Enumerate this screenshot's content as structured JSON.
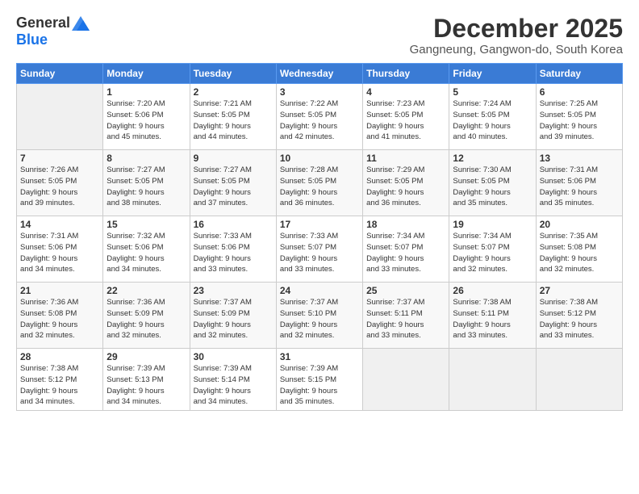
{
  "logo": {
    "general": "General",
    "blue": "Blue"
  },
  "title": "December 2025",
  "location": "Gangneung, Gangwon-do, South Korea",
  "days_of_week": [
    "Sunday",
    "Monday",
    "Tuesday",
    "Wednesday",
    "Thursday",
    "Friday",
    "Saturday"
  ],
  "weeks": [
    [
      {
        "day": "",
        "info": ""
      },
      {
        "day": "1",
        "info": "Sunrise: 7:20 AM\nSunset: 5:06 PM\nDaylight: 9 hours\nand 45 minutes."
      },
      {
        "day": "2",
        "info": "Sunrise: 7:21 AM\nSunset: 5:05 PM\nDaylight: 9 hours\nand 44 minutes."
      },
      {
        "day": "3",
        "info": "Sunrise: 7:22 AM\nSunset: 5:05 PM\nDaylight: 9 hours\nand 42 minutes."
      },
      {
        "day": "4",
        "info": "Sunrise: 7:23 AM\nSunset: 5:05 PM\nDaylight: 9 hours\nand 41 minutes."
      },
      {
        "day": "5",
        "info": "Sunrise: 7:24 AM\nSunset: 5:05 PM\nDaylight: 9 hours\nand 40 minutes."
      },
      {
        "day": "6",
        "info": "Sunrise: 7:25 AM\nSunset: 5:05 PM\nDaylight: 9 hours\nand 39 minutes."
      }
    ],
    [
      {
        "day": "7",
        "info": "Sunrise: 7:26 AM\nSunset: 5:05 PM\nDaylight: 9 hours\nand 39 minutes."
      },
      {
        "day": "8",
        "info": "Sunrise: 7:27 AM\nSunset: 5:05 PM\nDaylight: 9 hours\nand 38 minutes."
      },
      {
        "day": "9",
        "info": "Sunrise: 7:27 AM\nSunset: 5:05 PM\nDaylight: 9 hours\nand 37 minutes."
      },
      {
        "day": "10",
        "info": "Sunrise: 7:28 AM\nSunset: 5:05 PM\nDaylight: 9 hours\nand 36 minutes."
      },
      {
        "day": "11",
        "info": "Sunrise: 7:29 AM\nSunset: 5:05 PM\nDaylight: 9 hours\nand 36 minutes."
      },
      {
        "day": "12",
        "info": "Sunrise: 7:30 AM\nSunset: 5:05 PM\nDaylight: 9 hours\nand 35 minutes."
      },
      {
        "day": "13",
        "info": "Sunrise: 7:31 AM\nSunset: 5:06 PM\nDaylight: 9 hours\nand 35 minutes."
      }
    ],
    [
      {
        "day": "14",
        "info": "Sunrise: 7:31 AM\nSunset: 5:06 PM\nDaylight: 9 hours\nand 34 minutes."
      },
      {
        "day": "15",
        "info": "Sunrise: 7:32 AM\nSunset: 5:06 PM\nDaylight: 9 hours\nand 34 minutes."
      },
      {
        "day": "16",
        "info": "Sunrise: 7:33 AM\nSunset: 5:06 PM\nDaylight: 9 hours\nand 33 minutes."
      },
      {
        "day": "17",
        "info": "Sunrise: 7:33 AM\nSunset: 5:07 PM\nDaylight: 9 hours\nand 33 minutes."
      },
      {
        "day": "18",
        "info": "Sunrise: 7:34 AM\nSunset: 5:07 PM\nDaylight: 9 hours\nand 33 minutes."
      },
      {
        "day": "19",
        "info": "Sunrise: 7:34 AM\nSunset: 5:07 PM\nDaylight: 9 hours\nand 32 minutes."
      },
      {
        "day": "20",
        "info": "Sunrise: 7:35 AM\nSunset: 5:08 PM\nDaylight: 9 hours\nand 32 minutes."
      }
    ],
    [
      {
        "day": "21",
        "info": "Sunrise: 7:36 AM\nSunset: 5:08 PM\nDaylight: 9 hours\nand 32 minutes."
      },
      {
        "day": "22",
        "info": "Sunrise: 7:36 AM\nSunset: 5:09 PM\nDaylight: 9 hours\nand 32 minutes."
      },
      {
        "day": "23",
        "info": "Sunrise: 7:37 AM\nSunset: 5:09 PM\nDaylight: 9 hours\nand 32 minutes."
      },
      {
        "day": "24",
        "info": "Sunrise: 7:37 AM\nSunset: 5:10 PM\nDaylight: 9 hours\nand 32 minutes."
      },
      {
        "day": "25",
        "info": "Sunrise: 7:37 AM\nSunset: 5:11 PM\nDaylight: 9 hours\nand 33 minutes."
      },
      {
        "day": "26",
        "info": "Sunrise: 7:38 AM\nSunset: 5:11 PM\nDaylight: 9 hours\nand 33 minutes."
      },
      {
        "day": "27",
        "info": "Sunrise: 7:38 AM\nSunset: 5:12 PM\nDaylight: 9 hours\nand 33 minutes."
      }
    ],
    [
      {
        "day": "28",
        "info": "Sunrise: 7:38 AM\nSunset: 5:12 PM\nDaylight: 9 hours\nand 34 minutes."
      },
      {
        "day": "29",
        "info": "Sunrise: 7:39 AM\nSunset: 5:13 PM\nDaylight: 9 hours\nand 34 minutes."
      },
      {
        "day": "30",
        "info": "Sunrise: 7:39 AM\nSunset: 5:14 PM\nDaylight: 9 hours\nand 34 minutes."
      },
      {
        "day": "31",
        "info": "Sunrise: 7:39 AM\nSunset: 5:15 PM\nDaylight: 9 hours\nand 35 minutes."
      },
      {
        "day": "",
        "info": ""
      },
      {
        "day": "",
        "info": ""
      },
      {
        "day": "",
        "info": ""
      }
    ]
  ]
}
